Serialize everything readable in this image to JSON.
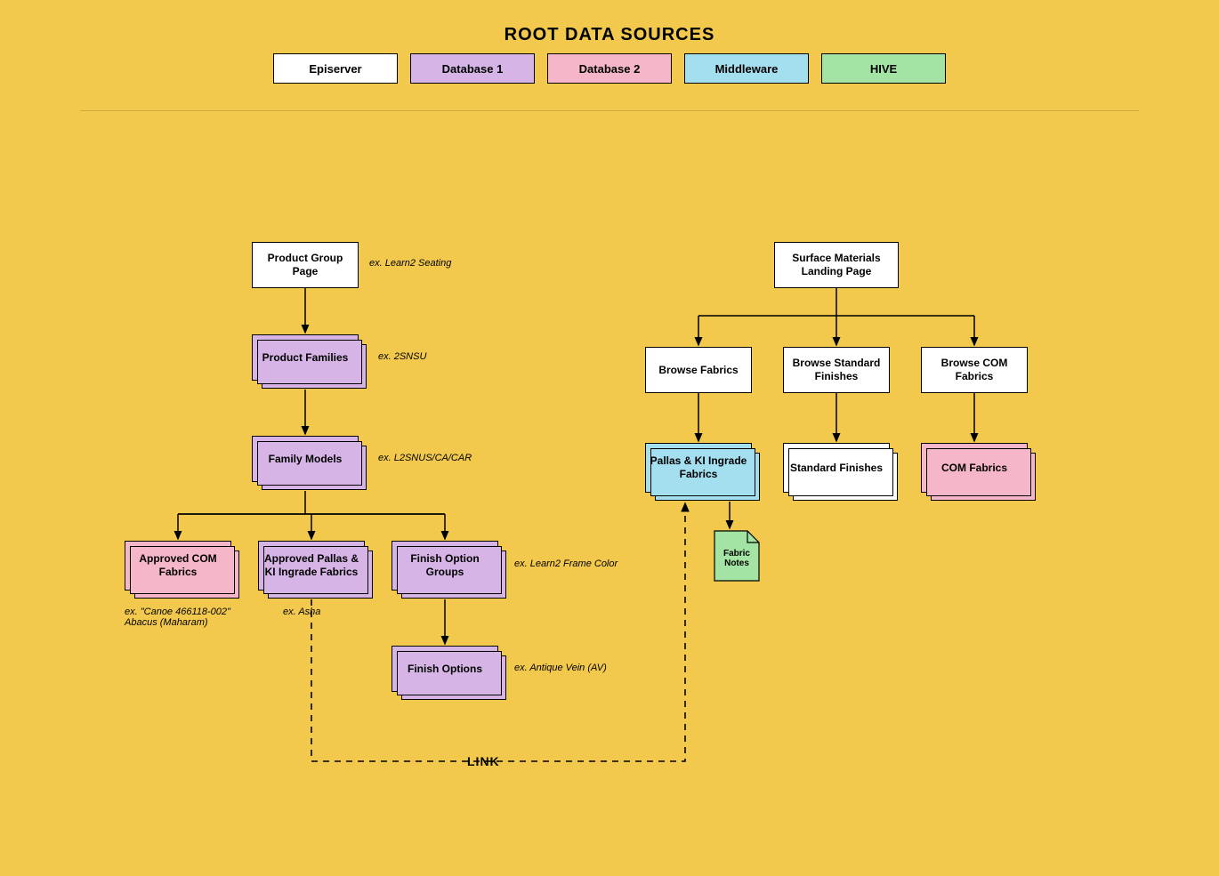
{
  "title": "ROOT DATA SOURCES",
  "legend": {
    "episerver": "Episerver",
    "db1": "Database 1",
    "db2": "Database 2",
    "middleware": "Middleware",
    "hive": "HIVE"
  },
  "colors": {
    "white": "#ffffff",
    "purple": "#d6b5e6",
    "pink": "#f4b6c8",
    "blue": "#a4dff0",
    "green": "#a3e3a3"
  },
  "left_tree": {
    "product_group_page": "Product Group Page",
    "product_group_page_ex": "ex. Learn2 Seating",
    "product_families": "Product Families",
    "product_families_ex": "ex. 2SNSU",
    "family_models": "Family Models",
    "family_models_ex": "ex. L2SNUS/CA/CAR",
    "approved_com_fabrics": "Approved COM Fabrics",
    "approved_com_fabrics_ex": "ex. \"Canoe 466118-002\" Abacus (Maharam)",
    "approved_pallas": "Approved Pallas & KI Ingrade Fabrics",
    "approved_pallas_ex": "ex. Asha",
    "finish_option_groups": "Finish Option Groups",
    "finish_option_groups_ex": "ex. Learn2 Frame Color",
    "finish_options": "Finish Options",
    "finish_options_ex": "ex. Antique Vein (AV)"
  },
  "right_tree": {
    "surface_materials": "Surface Materials Landing Page",
    "browse_fabrics": "Browse Fabrics",
    "browse_std_finishes": "Browse Standard Finishes",
    "browse_com_fabrics": "Browse COM Fabrics",
    "pallas_ki_ingrade": "Pallas & KI Ingrade Fabrics",
    "standard_finishes": "Standard Finishes",
    "com_fabrics": "COM Fabrics",
    "fabric_notes": "Fabric Notes"
  },
  "link_label": "LINK"
}
